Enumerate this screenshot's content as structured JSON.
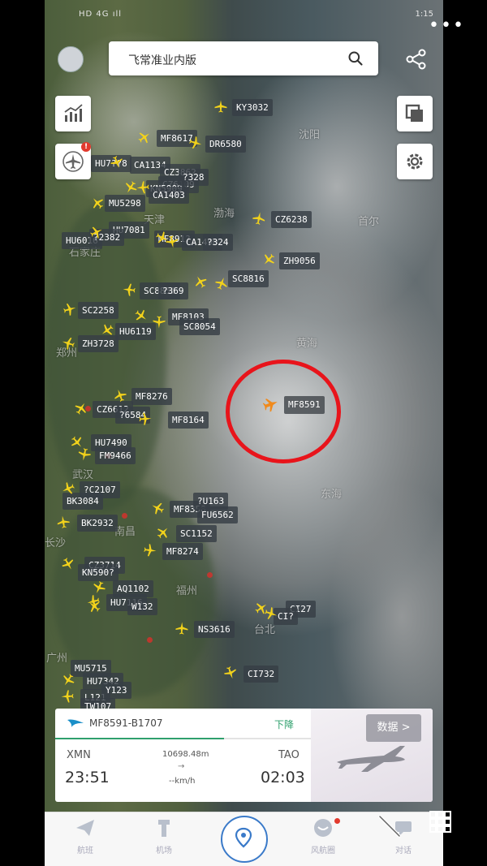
{
  "status_bar": {
    "left": "HD 4G ıll",
    "right": "1:15"
  },
  "search": {
    "placeholder": "飞常准业内版"
  },
  "cities": [
    {
      "name": "沈阳"
    },
    {
      "name": "渤海"
    },
    {
      "name": "天津"
    },
    {
      "name": "石家庄"
    },
    {
      "name": "郑州"
    },
    {
      "name": "武汉"
    },
    {
      "name": "长沙"
    },
    {
      "name": "南昌"
    },
    {
      "name": "福州"
    },
    {
      "name": "台北"
    },
    {
      "name": "广州"
    },
    {
      "name": "黄海"
    },
    {
      "name": "东海"
    },
    {
      "name": "首尔"
    }
  ],
  "flights": [
    "KY3032",
    "MF8617",
    "DR6580",
    "HU7??8",
    "CA1134",
    "CZ3862",
    "CZ6109",
    "KN5909",
    "CA1403",
    "MU5298",
    "CZ6238",
    "HU7081",
    "HU6016",
    "?2382",
    "MF891?",
    "CA1490",
    "?324",
    "ZH9056",
    "SC8858",
    "SC8816",
    "SC2258",
    "MF8103",
    "SC8054",
    "HU6119",
    "ZH3728",
    "MF8276",
    "CZ6612",
    "?6584",
    "MF8164",
    "HU7490",
    "FM9466",
    "?C2107",
    "BK3084",
    "MF8358",
    "?U163",
    "FU6562",
    "BK2932",
    "SC1152",
    "MF8274",
    "CZ3714",
    "KN590?",
    "AQ1102",
    "HU7116",
    "W132",
    "NS3616",
    "CI27",
    "CI?",
    "CI732",
    "HU7342",
    "L121",
    "TW107",
    "MU5715",
    "Y123",
    "?369",
    "?328"
  ],
  "selected": {
    "flight_label": "MF8591",
    "card_flight": "MF8591-B1707",
    "status": "下降",
    "from": "XMN",
    "to": "TAO",
    "dep_time": "23:51",
    "arr_time": "02:03",
    "altitude": "10698.48m",
    "arrow": "→",
    "speed": "--km/h",
    "progress": 0.66
  },
  "data_button": "数据 >",
  "nav": {
    "items": [
      {
        "label": "航班"
      },
      {
        "label": "机场"
      },
      {
        "label": ""
      },
      {
        "label": "风航圈"
      },
      {
        "label": "对话"
      }
    ]
  },
  "colors": {
    "accent_green": "#2fa06d",
    "nav_blue": "#3a7ac9",
    "plane_yellow": "#f2d21b",
    "highlight_red": "#e8141b"
  }
}
